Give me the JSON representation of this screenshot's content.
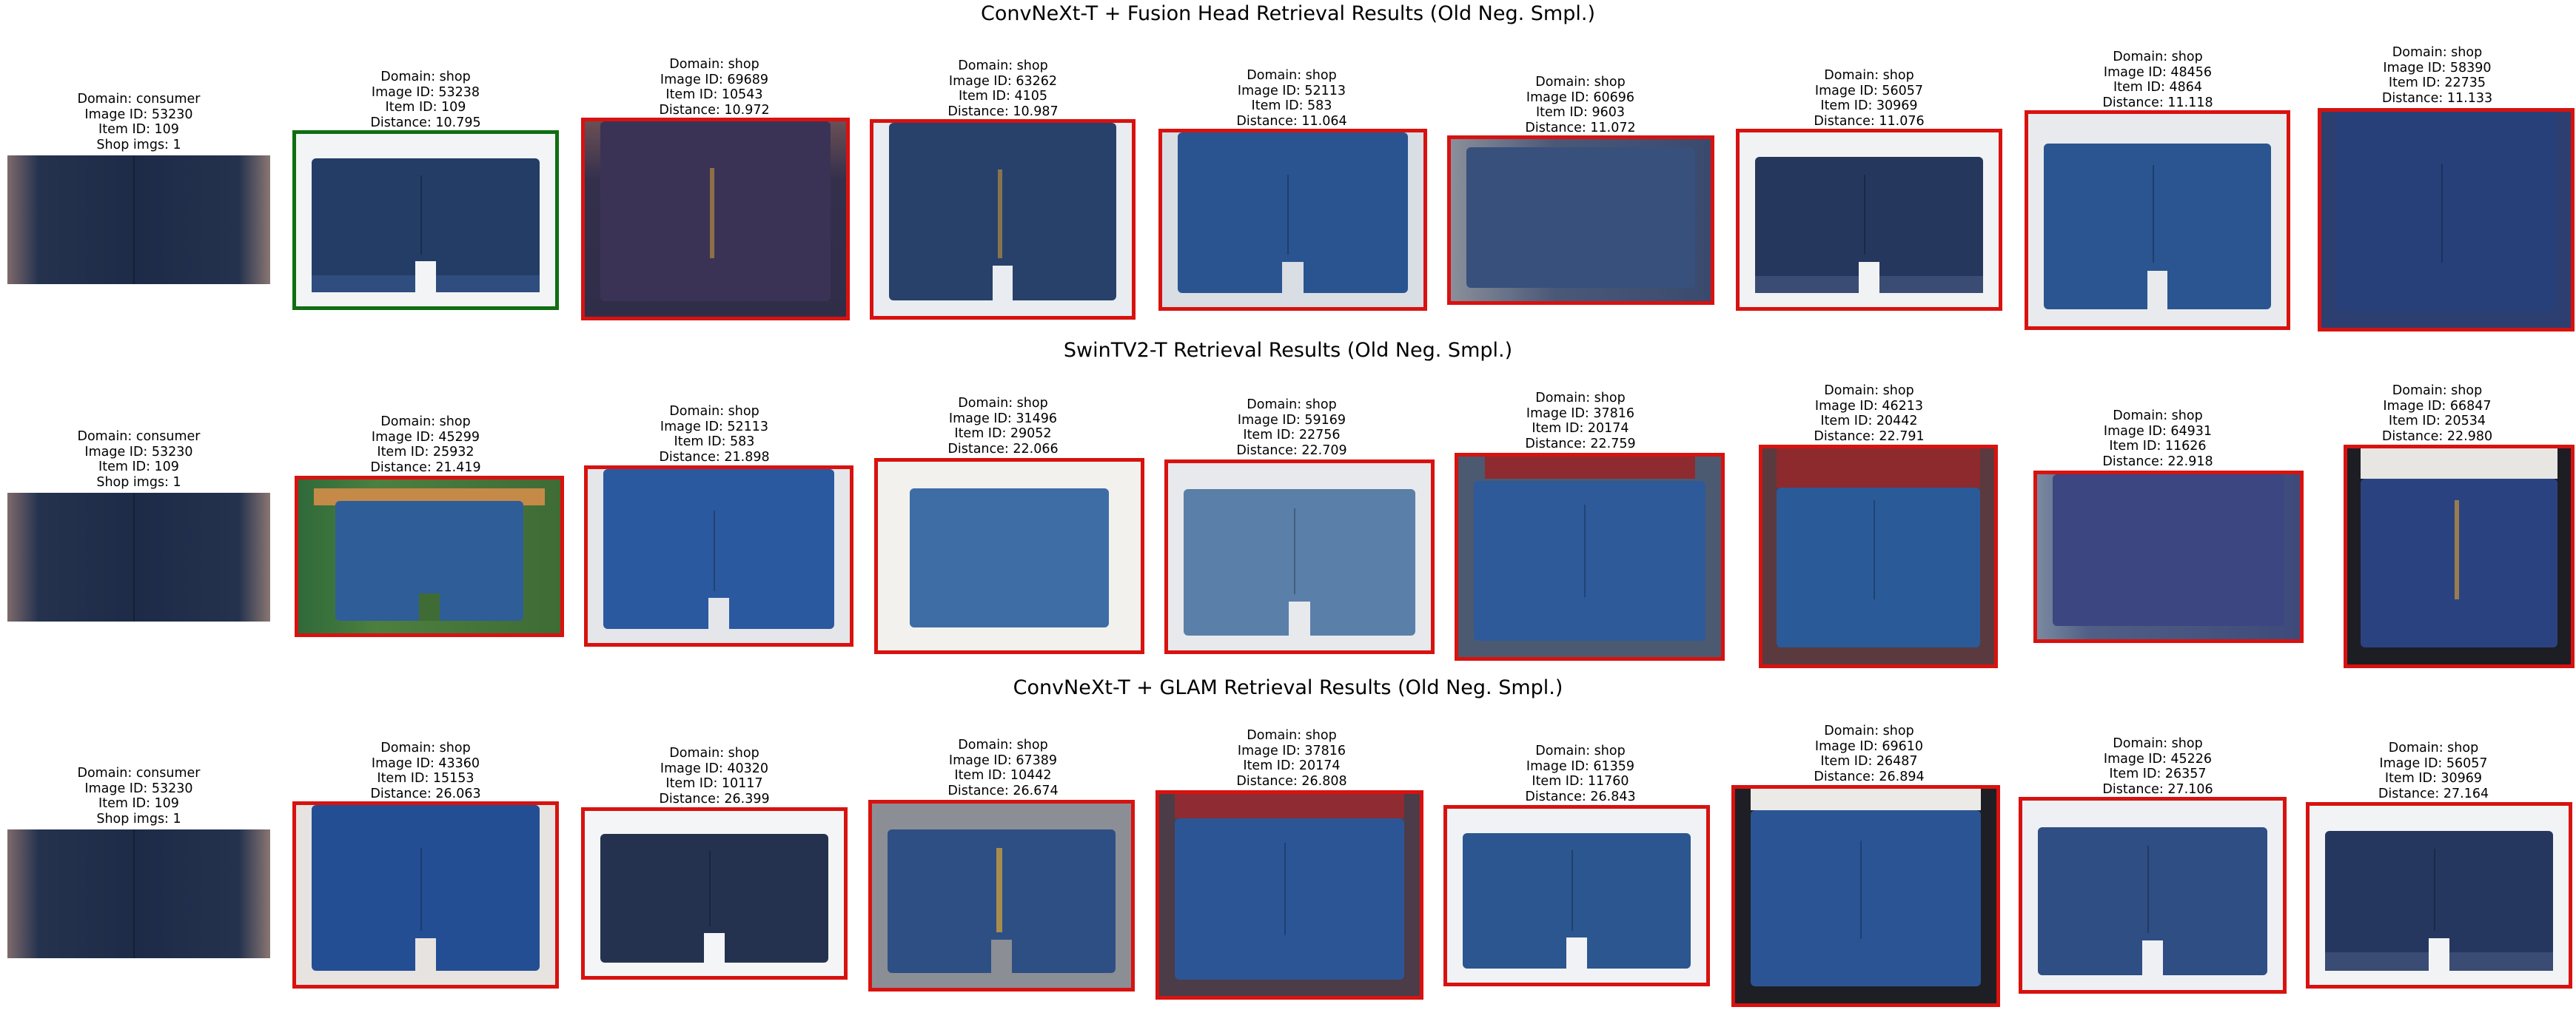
{
  "rows": [
    {
      "title": "ConvNeXt-T + Fusion Head Retrieval Results (Old Neg. Smpl.)",
      "query": {
        "domain": "Domain: consumer",
        "image_id": "Image ID: 53230",
        "item_id": "Item ID: 109",
        "extra": "Shop imgs: 1"
      },
      "results": [
        {
          "domain": "Domain: shop",
          "image_id": "Image ID: 53238",
          "item_id": "Item ID: 109",
          "distance": "Distance: 10.795",
          "match": true
        },
        {
          "domain": "Domain: shop",
          "image_id": "Image ID: 69689",
          "item_id": "Item ID: 10543",
          "distance": "Distance: 10.972",
          "match": false
        },
        {
          "domain": "Domain: shop",
          "image_id": "Image ID: 63262",
          "item_id": "Item ID: 4105",
          "distance": "Distance: 10.987",
          "match": false
        },
        {
          "domain": "Domain: shop",
          "image_id": "Image ID: 52113",
          "item_id": "Item ID: 583",
          "distance": "Distance: 11.064",
          "match": false
        },
        {
          "domain": "Domain: shop",
          "image_id": "Image ID: 60696",
          "item_id": "Item ID: 9603",
          "distance": "Distance: 11.072",
          "match": false
        },
        {
          "domain": "Domain: shop",
          "image_id": "Image ID: 56057",
          "item_id": "Item ID: 30969",
          "distance": "Distance: 11.076",
          "match": false
        },
        {
          "domain": "Domain: shop",
          "image_id": "Image ID: 48456",
          "item_id": "Item ID: 4864",
          "distance": "Distance: 11.118",
          "match": false
        },
        {
          "domain": "Domain: shop",
          "image_id": "Image ID: 58390",
          "item_id": "Item ID: 22735",
          "distance": "Distance: 11.133",
          "match": false
        }
      ]
    },
    {
      "title": "SwinTV2-T Retrieval Results (Old Neg. Smpl.)",
      "query": {
        "domain": "Domain: consumer",
        "image_id": "Image ID: 53230",
        "item_id": "Item ID: 109",
        "extra": "Shop imgs: 1"
      },
      "results": [
        {
          "domain": "Domain: shop",
          "image_id": "Image ID: 45299",
          "item_id": "Item ID: 25932",
          "distance": "Distance: 21.419",
          "match": false
        },
        {
          "domain": "Domain: shop",
          "image_id": "Image ID: 52113",
          "item_id": "Item ID: 583",
          "distance": "Distance: 21.898",
          "match": false
        },
        {
          "domain": "Domain: shop",
          "image_id": "Image ID: 31496",
          "item_id": "Item ID: 29052",
          "distance": "Distance: 22.066",
          "match": false
        },
        {
          "domain": "Domain: shop",
          "image_id": "Image ID: 59169",
          "item_id": "Item ID: 22756",
          "distance": "Distance: 22.709",
          "match": false
        },
        {
          "domain": "Domain: shop",
          "image_id": "Image ID: 37816",
          "item_id": "Item ID: 20174",
          "distance": "Distance: 22.759",
          "match": false
        },
        {
          "domain": "Domain: shop",
          "image_id": "Image ID: 46213",
          "item_id": "Item ID: 20442",
          "distance": "Distance: 22.791",
          "match": false
        },
        {
          "domain": "Domain: shop",
          "image_id": "Image ID: 64931",
          "item_id": "Item ID: 11626",
          "distance": "Distance: 22.918",
          "match": false
        },
        {
          "domain": "Domain: shop",
          "image_id": "Image ID: 66847",
          "item_id": "Item ID: 20534",
          "distance": "Distance: 22.980",
          "match": false
        }
      ]
    },
    {
      "title": "ConvNeXt-T + GLAM Retrieval Results (Old Neg. Smpl.)",
      "query": {
        "domain": "Domain: consumer",
        "image_id": "Image ID: 53230",
        "item_id": "Item ID: 109",
        "extra": "Shop imgs: 1"
      },
      "results": [
        {
          "domain": "Domain: shop",
          "image_id": "Image ID: 43360",
          "item_id": "Item ID: 15153",
          "distance": "Distance: 26.063",
          "match": false
        },
        {
          "domain": "Domain: shop",
          "image_id": "Image ID: 40320",
          "item_id": "Item ID: 10117",
          "distance": "Distance: 26.399",
          "match": false
        },
        {
          "domain": "Domain: shop",
          "image_id": "Image ID: 67389",
          "item_id": "Item ID: 10442",
          "distance": "Distance: 26.674",
          "match": false
        },
        {
          "domain": "Domain: shop",
          "image_id": "Image ID: 37816",
          "item_id": "Item ID: 20174",
          "distance": "Distance: 26.808",
          "match": false
        },
        {
          "domain": "Domain: shop",
          "image_id": "Image ID: 61359",
          "item_id": "Item ID: 11760",
          "distance": "Distance: 26.843",
          "match": false
        },
        {
          "domain": "Domain: shop",
          "image_id": "Image ID: 69610",
          "item_id": "Item ID: 26487",
          "distance": "Distance: 26.894",
          "match": false
        },
        {
          "domain": "Domain: shop",
          "image_id": "Image ID: 45226",
          "item_id": "Item ID: 26357",
          "distance": "Distance: 27.106",
          "match": false
        },
        {
          "domain": "Domain: shop",
          "image_id": "Image ID: 56057",
          "item_id": "Item ID: 30969",
          "distance": "Distance: 27.164",
          "match": false
        }
      ]
    }
  ],
  "colors": {
    "match_border": "#0f6e12",
    "mismatch_border": "#d8120f"
  }
}
